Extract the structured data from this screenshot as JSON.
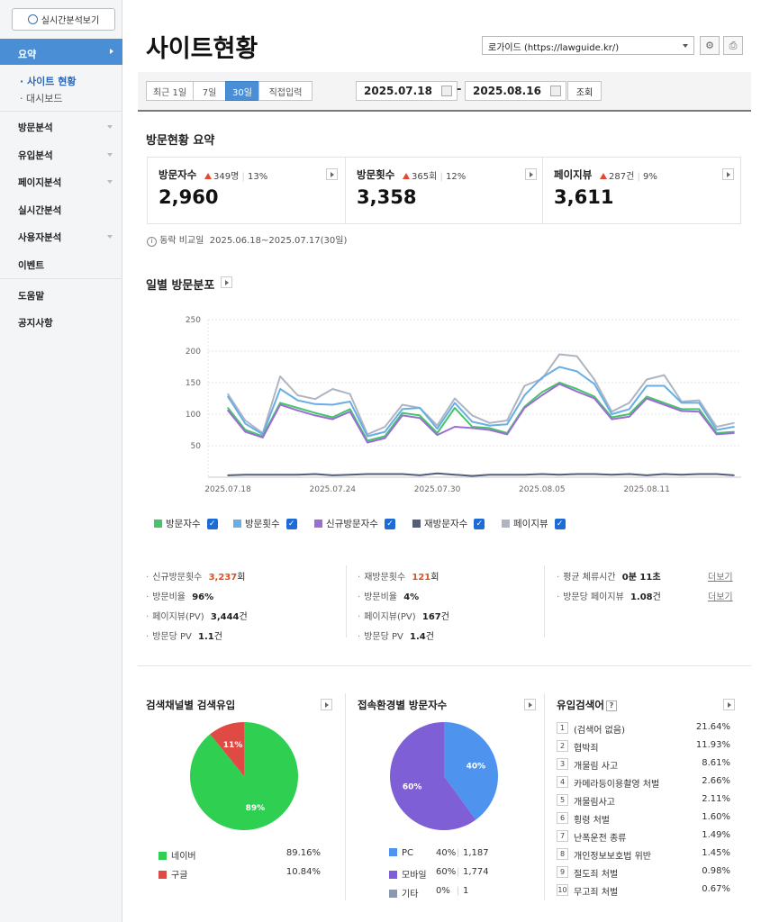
{
  "sidebar": {
    "realtime_button": "실시간분석보기",
    "selected_menu": "요약",
    "sub_items": [
      "· 사이트 현황",
      "· 대시보드"
    ],
    "menu": [
      "방문분석",
      "유입분석",
      "페이지분석",
      "실시간분석",
      "사용자분석",
      "이벤트",
      "도움말",
      "공지사항"
    ]
  },
  "header": {
    "title": "사이트현황",
    "site": "로가이드 (https://lawguide.kr/)"
  },
  "filter": {
    "ranges": [
      "최근 1일",
      "7일",
      "30일",
      "직접입력"
    ],
    "selected": "30일",
    "start": "2025.07.18",
    "end": "2025.08.16",
    "dash": "-",
    "search": "조회"
  },
  "summary": {
    "title": "방문현황 요약",
    "cards": [
      {
        "label": "방문자수",
        "diff": "349명",
        "pct": "13%",
        "value": "2,960"
      },
      {
        "label": "방문횟수",
        "diff": "365회",
        "pct": "12%",
        "value": "3,358"
      },
      {
        "label": "페이지뷰",
        "diff": "287건",
        "pct": "9%",
        "value": "3,611"
      }
    ],
    "compare_label": "동락 비교일",
    "compare_range": "2025.06.18~2025.07.17(30일)"
  },
  "daily": {
    "title": "일별 방문분포"
  },
  "chart_data": {
    "type": "line",
    "x": [
      "2025.07.18",
      "2025.07.19",
      "2025.07.20",
      "2025.07.21",
      "2025.07.22",
      "2025.07.23",
      "2025.07.24",
      "2025.07.25",
      "2025.07.26",
      "2025.07.27",
      "2025.07.28",
      "2025.07.29",
      "2025.07.30",
      "2025.07.31",
      "2025.08.01",
      "2025.08.02",
      "2025.08.03",
      "2025.08.04",
      "2025.08.05",
      "2025.08.06",
      "2025.08.07",
      "2025.08.08",
      "2025.08.09",
      "2025.08.10",
      "2025.08.11",
      "2025.08.12",
      "2025.08.13",
      "2025.08.14",
      "2025.08.15",
      "2025.08.16"
    ],
    "x_tick_labels": [
      "2025.07.18",
      "2025.07.24",
      "2025.07.30",
      "2025.08.05",
      "2025.08.11"
    ],
    "ylim": [
      0,
      250
    ],
    "yticks": [
      50,
      100,
      150,
      200,
      250
    ],
    "grid": true,
    "series": [
      {
        "name": "방문자수",
        "color": "#46c46a",
        "values": [
          110,
          75,
          65,
          118,
          110,
          102,
          95,
          108,
          58,
          65,
          102,
          98,
          70,
          110,
          80,
          78,
          70,
          112,
          135,
          150,
          140,
          128,
          95,
          100,
          128,
          118,
          108,
          108,
          70,
          72
        ]
      },
      {
        "name": "방문횟수",
        "color": "#6aaee4",
        "values": [
          128,
          85,
          68,
          140,
          122,
          116,
          115,
          120,
          65,
          72,
          108,
          110,
          77,
          118,
          88,
          82,
          84,
          130,
          158,
          175,
          168,
          148,
          100,
          108,
          145,
          145,
          118,
          118,
          75,
          80
        ]
      },
      {
        "name": "신규방문자수",
        "color": "#9b6ed6",
        "values": [
          106,
          72,
          63,
          115,
          106,
          98,
          92,
          104,
          55,
          62,
          98,
          94,
          67,
          80,
          78,
          75,
          68,
          110,
          130,
          148,
          136,
          125,
          92,
          96,
          125,
          115,
          105,
          104,
          68,
          70
        ]
      },
      {
        "name": "재방문자수",
        "color": "#545e7a",
        "values": [
          3,
          4,
          4,
          4,
          4,
          5,
          3,
          4,
          5,
          5,
          5,
          3,
          6,
          4,
          2,
          4,
          4,
          4,
          5,
          4,
          5,
          5,
          4,
          5,
          3,
          5,
          4,
          5,
          5,
          3
        ]
      },
      {
        "name": "페이지뷰",
        "color": "#aeb5c2",
        "values": [
          132,
          90,
          70,
          160,
          130,
          124,
          140,
          132,
          68,
          80,
          115,
          110,
          82,
          125,
          98,
          86,
          90,
          145,
          156,
          195,
          192,
          155,
          104,
          118,
          155,
          162,
          120,
          122,
          80,
          86
        ]
      }
    ]
  },
  "stats": {
    "col1": [
      {
        "label": "신규방문횟수",
        "value": "3,237",
        "unit": "회"
      },
      {
        "label": "방문비율",
        "value": "96%",
        "unit": ""
      },
      {
        "label": "페이지뷰(PV)",
        "value": "3,444",
        "unit": "건"
      },
      {
        "label": "방문당 PV",
        "value": "1.1",
        "unit": "건"
      }
    ],
    "col2": [
      {
        "label": "재방문횟수",
        "value": "121",
        "unit": "회"
      },
      {
        "label": "방문비율",
        "value": "4%",
        "unit": ""
      },
      {
        "label": "페이지뷰(PV)",
        "value": "167",
        "unit": "건"
      },
      {
        "label": "방문당 PV",
        "value": "1.4",
        "unit": "건"
      }
    ],
    "col3": [
      {
        "label": "평균 체류시간",
        "value": "0분 11초",
        "unit": "",
        "more": "더보기"
      },
      {
        "label": "방문당 페이지뷰",
        "value": "1.08",
        "unit": "건",
        "more": "더보기"
      }
    ]
  },
  "search_channel": {
    "title": "검색채널별 검색유입",
    "slices": [
      {
        "name": "네이버",
        "value": 89.16,
        "pct": "89.16%",
        "label": "89%",
        "color": "#2fcf52"
      },
      {
        "name": "구글",
        "value": 10.84,
        "pct": "10.84%",
        "label": "11%",
        "color": "#e04a44"
      }
    ]
  },
  "env": {
    "title": "접속환경별 방문자수",
    "slices": [
      {
        "name": "PC",
        "value": 40,
        "pct": "40%",
        "count": "1,187",
        "label": "40%",
        "color": "#4e94ef"
      },
      {
        "name": "모바일",
        "value": 60,
        "pct": "60%",
        "count": "1,774",
        "label": "60%",
        "color": "#7f5fd6"
      },
      {
        "name": "기타",
        "value": 0,
        "pct": "0%",
        "count": "1",
        "label": "",
        "color": "#8a97ae"
      }
    ]
  },
  "keywords": {
    "title": "유입검색어",
    "help": "?",
    "items": [
      {
        "rank": "1",
        "term": "(검색어 없음)",
        "pct": "21.64%"
      },
      {
        "rank": "2",
        "term": "협박죄",
        "pct": "11.93%"
      },
      {
        "rank": "3",
        "term": "개물림 사고",
        "pct": "8.61%"
      },
      {
        "rank": "4",
        "term": "카메라등이용촬영 처벌",
        "pct": "2.66%"
      },
      {
        "rank": "5",
        "term": "개물림사고",
        "pct": "2.11%"
      },
      {
        "rank": "6",
        "term": "횡령 처벌",
        "pct": "1.60%"
      },
      {
        "rank": "7",
        "term": "난폭운전 종류",
        "pct": "1.49%"
      },
      {
        "rank": "8",
        "term": "개인정보보호법 위반",
        "pct": "1.45%"
      },
      {
        "rank": "9",
        "term": "절도죄 처벌",
        "pct": "0.98%"
      },
      {
        "rank": "10",
        "term": "무고죄 처벌",
        "pct": "0.67%"
      }
    ]
  }
}
